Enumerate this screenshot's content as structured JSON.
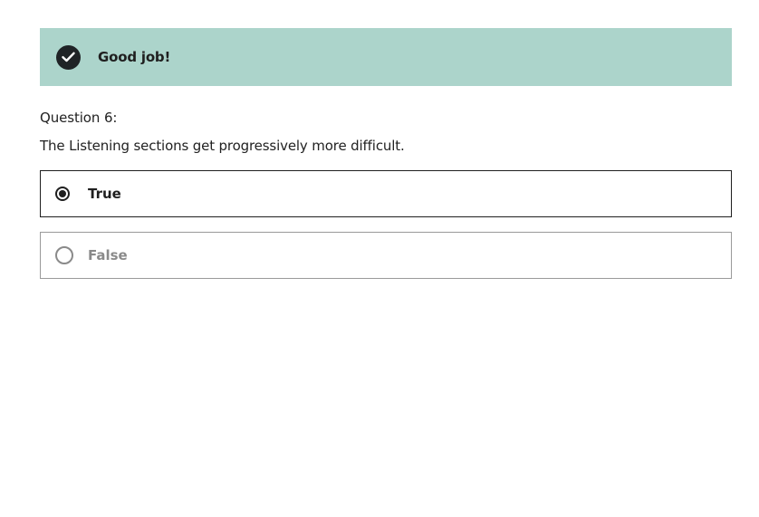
{
  "feedback": {
    "message": "Good job!",
    "icon": "check-circle-icon",
    "background": "#acd4cb"
  },
  "question": {
    "number_label": "Question 6:",
    "text": "The Listening sections get progressively more difficult."
  },
  "options": [
    {
      "label": "True",
      "selected": true
    },
    {
      "label": "False",
      "selected": false
    }
  ]
}
